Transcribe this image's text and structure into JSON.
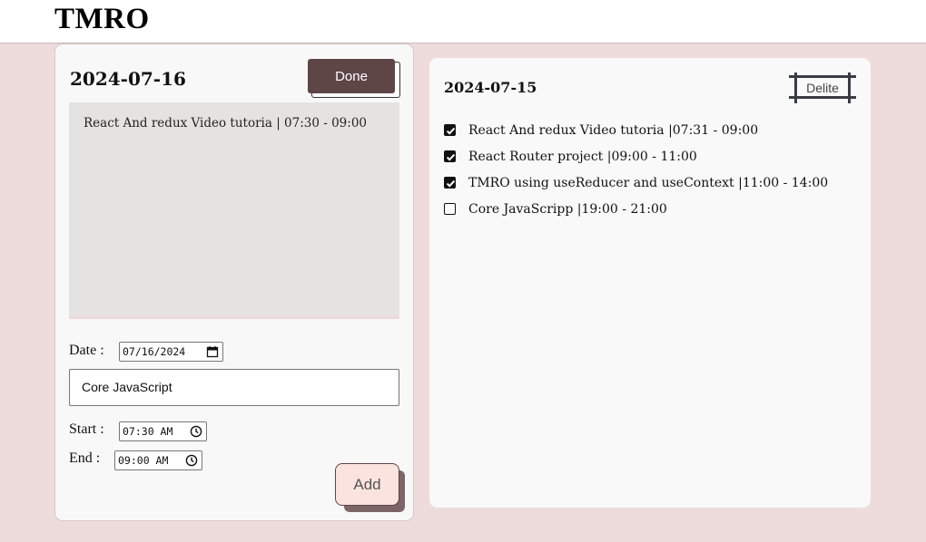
{
  "header": {
    "title": "TMRO"
  },
  "editor": {
    "date_heading": "2024-07-16",
    "done_label": "Done",
    "preview_text": "React And redux Video tutoria | 07:30 - 09:00",
    "date_label": "Date :",
    "date_value": "07/16/2024",
    "task_value": "Core JavaScript",
    "start_label": "Start :",
    "start_value": "07:30 AM",
    "end_label": "End :",
    "end_value": "09:00 AM",
    "add_label": "Add"
  },
  "day_list": {
    "date_heading": "2024-07-15",
    "delete_label": "Delite",
    "items": [
      {
        "text": "React And redux Video tutoria |07:31 - 09:00",
        "checked": true
      },
      {
        "text": "React Router project |09:00 - 11:00",
        "checked": true
      },
      {
        "text": "TMRO using useReducer and useContext |11:00 - 14:00",
        "checked": true
      },
      {
        "text": "Core JavaScripp |19:00 - 21:00",
        "checked": false
      }
    ]
  },
  "colors": {
    "page_background": "#eedcdc",
    "accent_dark": "#5e4546",
    "add_button_bg": "#fbe3e0",
    "preview_bg": "#e5e3e1"
  }
}
